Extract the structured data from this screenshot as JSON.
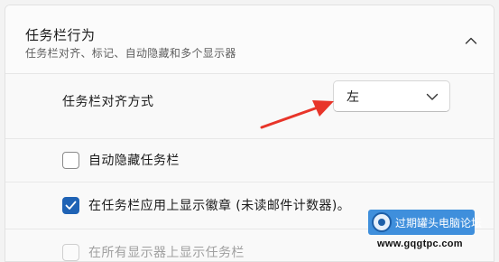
{
  "section": {
    "title": "任务栏行为",
    "subtitle": "任务栏对齐、标记、自动隐藏和多个显示器"
  },
  "alignment": {
    "label": "任务栏对齐方式",
    "selected": "左"
  },
  "options": [
    {
      "label": "自动隐藏任务栏",
      "checked": false,
      "disabled": false
    },
    {
      "label": "在任务栏应用上显示徽章 (未读邮件计数器)。",
      "checked": true,
      "disabled": false
    },
    {
      "label": "在所有显示器上显示任务栏",
      "checked": false,
      "disabled": true
    }
  ],
  "watermark": {
    "brand": "过期罐头电脑论坛",
    "url": "www.gqgtpc.com"
  },
  "colors": {
    "accent": "#1f63b5",
    "annotation_arrow": "#e8352a",
    "watermark_bg": "#3f8fdc"
  },
  "icons": {
    "header": "chevron-up-icon",
    "dropdown": "chevron-down-icon",
    "checkmark": "checkmark-icon",
    "annotation": "red-arrow-annotation"
  }
}
